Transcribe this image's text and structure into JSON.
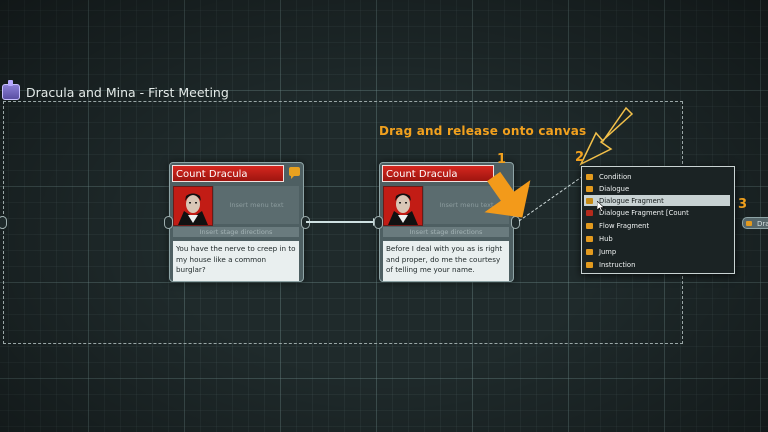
{
  "flow": {
    "title": "Dracula and Mina - First Meeting"
  },
  "nodes": [
    {
      "speaker": "Count Dracula",
      "menu_placeholder": "Insert menu text",
      "stage_placeholder": "Insert stage directions",
      "text": "You have the nerve to creep in to my house like a common burglar?"
    },
    {
      "speaker": "Count Dracula",
      "menu_placeholder": "Insert menu text",
      "stage_placeholder": "Insert stage directions",
      "text": "Before I deal with you as is right and proper, do me the courtesy of telling me your name."
    }
  ],
  "annotation": {
    "instruction": "Drag and release onto canvas",
    "steps": [
      "1",
      "2",
      "3"
    ]
  },
  "menu": {
    "items": [
      {
        "label": "Condition",
        "icon": "condition-icon"
      },
      {
        "label": "Dialogue",
        "icon": "dialogue-icon"
      },
      {
        "label": "Dialogue Fragment",
        "icon": "dialogue-fragment-icon"
      },
      {
        "label": "Dialogue Fragment [Count",
        "icon": "character-icon"
      },
      {
        "label": "Flow Fragment",
        "icon": "flow-fragment-icon"
      },
      {
        "label": "Hub",
        "icon": "hub-icon"
      },
      {
        "label": "Jump",
        "icon": "jump-icon"
      },
      {
        "label": "Instruction",
        "icon": "instruction-icon"
      }
    ],
    "highlighted_index": 2
  },
  "side_node": {
    "label": "Dra"
  },
  "colors": {
    "accent": "#f2a11e",
    "header_red": "#c8211a"
  }
}
